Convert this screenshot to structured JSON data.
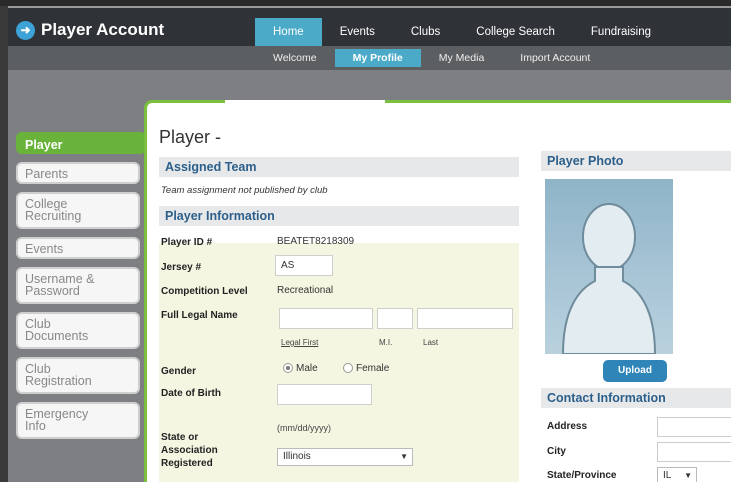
{
  "app": {
    "title": "Player Account",
    "logo_icon": "arrow-circle-icon"
  },
  "main_nav": {
    "items": [
      "Home",
      "Events",
      "Clubs",
      "College Search",
      "Fundraising"
    ],
    "active": "Home"
  },
  "sub_nav": {
    "items": [
      "Welcome",
      "My Profile",
      "My Media",
      "Import Account"
    ],
    "active": "My Profile"
  },
  "sidebar": {
    "items": [
      "Player",
      "Parents",
      "College\nRecruiting",
      "Events",
      "Username &\nPassword",
      "Club\nDocuments",
      "Club\nRegistration",
      "Emergency\nInfo"
    ],
    "active": "Player"
  },
  "page": {
    "title": "Player -"
  },
  "assigned_team": {
    "heading": "Assigned Team",
    "note": "Team assignment not published by club"
  },
  "player_info": {
    "heading": "Player Information",
    "player_id_label": "Player ID #",
    "player_id_value": "BEATET8218309",
    "jersey_label": "Jersey #",
    "jersey_value": "AS",
    "competition_label": "Competition Level",
    "competition_value": "Recreational",
    "full_name_label": "Full Legal Name",
    "name_sublabels": {
      "first": "Legal First",
      "middle": "M.I.",
      "last": "Last"
    },
    "gender_label": "Gender",
    "gender_options": [
      "Male",
      "Female"
    ],
    "gender_selected": "Male",
    "dob_label": "Date of Birth",
    "dob_hint": "(mm/dd/yyyy)",
    "state_label": "State or\nAssociation\nRegistered",
    "state_value": "Illinois"
  },
  "photo": {
    "heading": "Player Photo",
    "upload_label": "Upload"
  },
  "contact": {
    "heading": "Contact Information",
    "address_label": "Address",
    "city_label": "City",
    "state_label": "State/Province",
    "state_value": "IL"
  },
  "colors": {
    "accent_green": "#6ab33a",
    "nav_blue": "#4aaac8",
    "heading_blue": "#2c5f8a",
    "upload_blue": "#2f85b8"
  }
}
